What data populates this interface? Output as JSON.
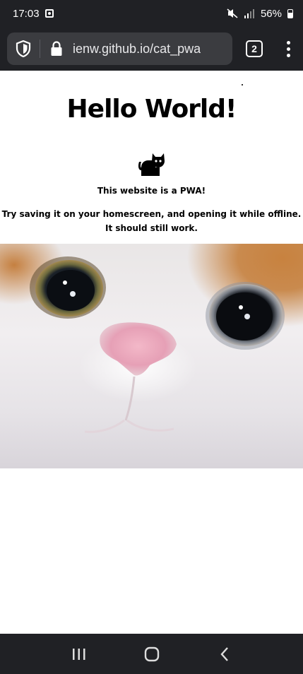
{
  "status_bar": {
    "time": "17:03",
    "battery": "56%",
    "icons": [
      "notification-icon",
      "mute-icon",
      "signal-icon",
      "battery-icon"
    ]
  },
  "browser": {
    "url": "ienw.github.io/cat_pwa",
    "tab_count": "2",
    "icons": [
      "shield-icon",
      "lock-icon",
      "menu-icon"
    ]
  },
  "page": {
    "heading": "Hello World!",
    "subtitle": "This website is a PWA!",
    "instructions": "Try saving it on your homescreen, and opening it while offline. It should still work.",
    "image": {
      "subject": "cat face close-up"
    }
  },
  "nav_bar": {
    "icons": [
      "recent-apps-icon",
      "home-icon",
      "back-icon"
    ]
  },
  "colors": {
    "chrome_background": "#202125",
    "url_box_background": "#3b3c40",
    "page_background": "#ffffff",
    "text": "#000000"
  }
}
